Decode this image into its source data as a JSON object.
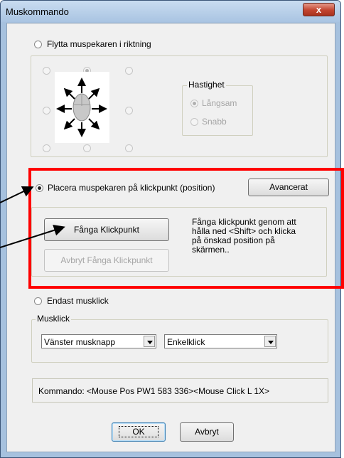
{
  "window": {
    "title": "Muskommando",
    "close_glyph": "x"
  },
  "move_direction": {
    "label": "Flytta muspekaren i riktning",
    "selected": false
  },
  "speed": {
    "label": "Hastighet",
    "options": [
      "Långsam",
      "Snabb"
    ],
    "selected": "Långsam"
  },
  "click_position": {
    "label": "Placera muspekaren på klickpunkt (position)",
    "selected": true,
    "advanced_button": "Avancerat",
    "capture_button": "Fånga Klickpunkt",
    "cancel_capture_button": "Avbryt Fånga Klickpunkt",
    "instructions": [
      "Fånga klickpunkt genom att",
      "hålla ned <Shift> och klicka",
      "på önskad position på",
      "skärmen.."
    ]
  },
  "mouse_click_only": {
    "label": "Endast musklick",
    "selected": false
  },
  "mouse_click": {
    "label": "Musklick",
    "button_value": "Vänster musknapp",
    "type_value": "Enkelklick"
  },
  "command": {
    "text": "Kommando: <Mouse Pos PW1 583 336><Mouse Click L 1X>"
  },
  "footer": {
    "ok_label": "OK",
    "cancel_label": "Avbryt"
  },
  "colors": {
    "annotation_red": "#ff0000",
    "title_bar": "#b9d1ea"
  }
}
